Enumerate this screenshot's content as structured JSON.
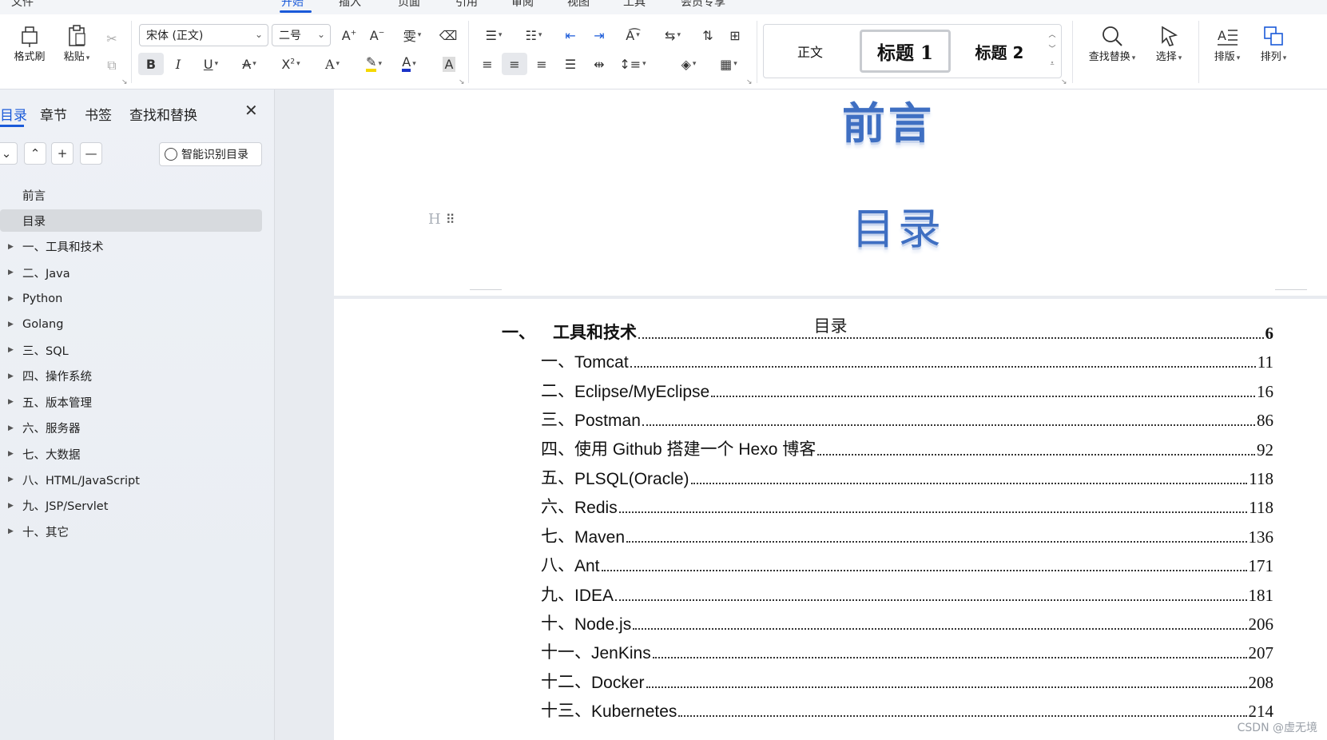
{
  "menubar": {
    "items": [
      "文件",
      "开始",
      "插入",
      "页面",
      "引用",
      "审阅",
      "视图",
      "工具",
      "会员专享"
    ],
    "active": "开始"
  },
  "ribbon": {
    "format_painter": "格式刷",
    "paste": "粘贴",
    "font_name": "宋体 (正文)",
    "font_size": "二号",
    "find_replace": "查找替换",
    "select": "选择",
    "layout": "排版",
    "arrange": "排列",
    "bold": "B",
    "italic": "I",
    "underline": "U",
    "styles": [
      {
        "label": "正文"
      },
      {
        "label": "标题 1"
      },
      {
        "label": "标题 2"
      }
    ]
  },
  "nav": {
    "tabs": [
      "目录",
      "章节",
      "书签",
      "查找和替换"
    ],
    "active_tab": "目录",
    "smart_button": "智能识别目录",
    "items": [
      {
        "label": "前言",
        "expandable": false
      },
      {
        "label": "目录",
        "expandable": false,
        "selected": true
      },
      {
        "label": "一、工具和技术",
        "expandable": true
      },
      {
        "label": "二、Java",
        "expandable": true
      },
      {
        "label": "Python",
        "expandable": true
      },
      {
        "label": "Golang",
        "expandable": true
      },
      {
        "label": "三、SQL",
        "expandable": true
      },
      {
        "label": "四、操作系统",
        "expandable": true
      },
      {
        "label": "五、版本管理",
        "expandable": true
      },
      {
        "label": "六、服务器",
        "expandable": true
      },
      {
        "label": "七、大数据",
        "expandable": true
      },
      {
        "label": "八、HTML/JavaScript",
        "expandable": true
      },
      {
        "label": "九、JSP/Servlet",
        "expandable": true
      },
      {
        "label": "十、其它",
        "expandable": true
      }
    ]
  },
  "document": {
    "heading_preface": "前言",
    "heading_toc": "目录",
    "heading_marker": "H",
    "toc_title": "目录",
    "toc": [
      {
        "num": "一、",
        "title": "工具和技术",
        "page": "6",
        "level": 1
      },
      {
        "num": "一、",
        "title": "Tomcat",
        "page": "11",
        "level": 2
      },
      {
        "num": "二、",
        "title": "Eclipse/MyEclipse",
        "page": "16",
        "level": 2
      },
      {
        "num": "三、",
        "title": "Postman",
        "page": "86",
        "level": 2
      },
      {
        "num": "四、",
        "title": "使用 Github 搭建一个 Hexo 博客",
        "page": "92",
        "level": 2
      },
      {
        "num": "五、",
        "title": "PLSQL(Oracle)",
        "page": "118",
        "level": 2
      },
      {
        "num": "六、",
        "title": "Redis",
        "page": "118",
        "level": 2
      },
      {
        "num": "七、",
        "title": "Maven",
        "page": "136",
        "level": 2
      },
      {
        "num": "八、",
        "title": "Ant",
        "page": "171",
        "level": 2
      },
      {
        "num": "九、",
        "title": "IDEA",
        "page": "181",
        "level": 2
      },
      {
        "num": "十、",
        "title": "Node.js",
        "page": "206",
        "level": 2
      },
      {
        "num": "十一、",
        "title": "JenKins",
        "page": "207",
        "level": 2
      },
      {
        "num": "十二、",
        "title": "Docker",
        "page": "208",
        "level": 2
      },
      {
        "num": "十三、",
        "title": "Kubernetes",
        "page": "214",
        "level": 2
      }
    ],
    "watermark": "CSDN @虚无境"
  }
}
